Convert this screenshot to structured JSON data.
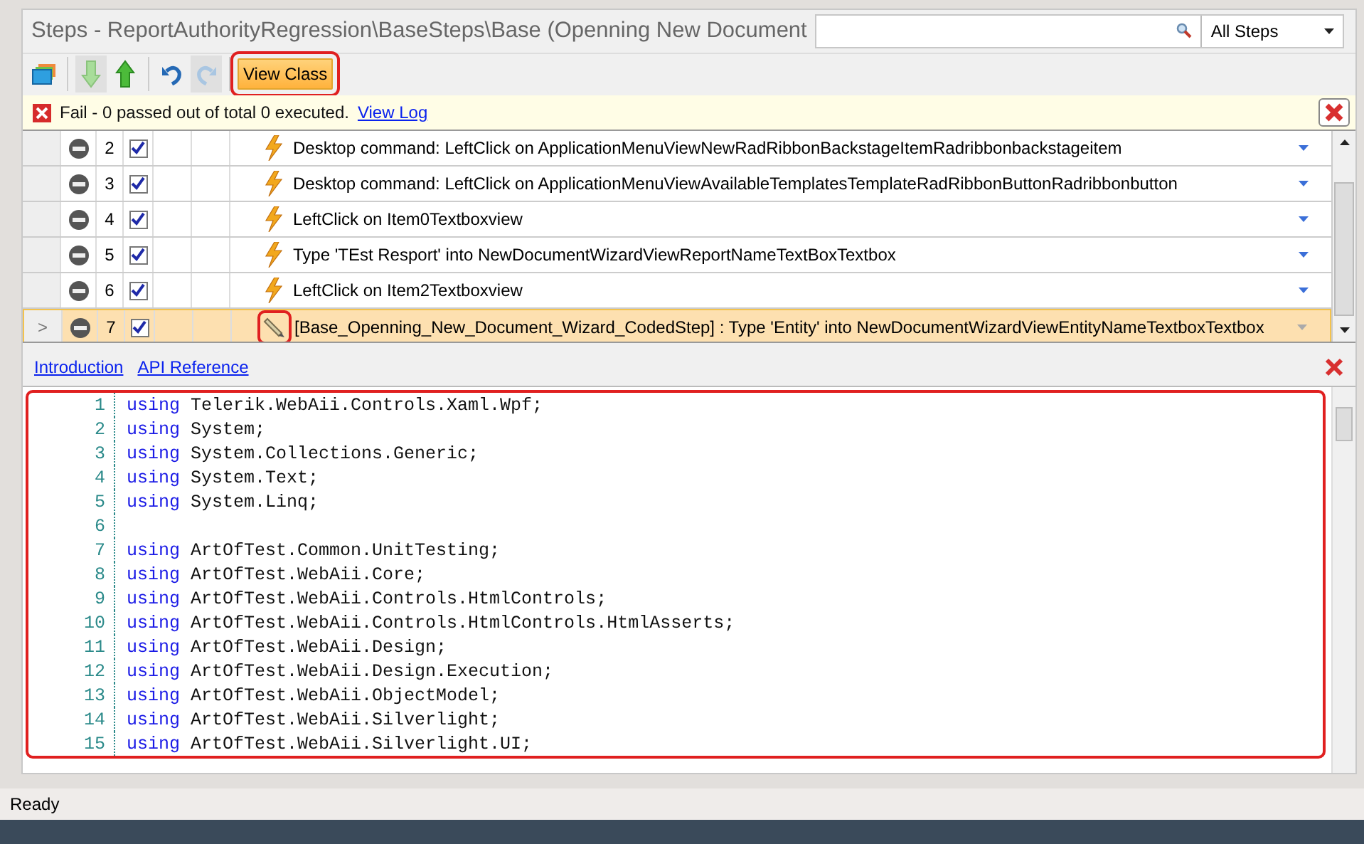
{
  "panel": {
    "title": "Steps - ReportAuthorityRegression\\BaseSteps\\Base (Openning New Document"
  },
  "filter": {
    "scope": "All Steps"
  },
  "toolbar": [
    {
      "kind": "windows",
      "disabled": false
    },
    {
      "kind": "down",
      "disabled": true
    },
    {
      "kind": "up",
      "disabled": false
    },
    {
      "kind": "undo",
      "disabled": false
    },
    {
      "kind": "redo",
      "disabled": true
    },
    {
      "kind": "text",
      "label": "View Class",
      "highlighted": true
    }
  ],
  "result_bar": {
    "message": "Fail - 0 passed out of total 0 executed.",
    "link": "View Log"
  },
  "steps": [
    {
      "number": "2",
      "checked": true,
      "kind": "desktop",
      "description": "Desktop command: LeftClick on ApplicationMenuViewNewRadRibbonBackstageItemRadribbonbackstageitem",
      "selected": false,
      "highlighted": false
    },
    {
      "number": "3",
      "checked": true,
      "kind": "desktop",
      "description": "Desktop command: LeftClick on ApplicationMenuViewAvailableTemplatesTemplateRadRibbonButtonRadribbonbutton",
      "selected": false,
      "highlighted": false
    },
    {
      "number": "4",
      "checked": true,
      "kind": "desktop",
      "description": "LeftClick on Item0Textboxview",
      "selected": false,
      "highlighted": false
    },
    {
      "number": "5",
      "checked": true,
      "kind": "desktop",
      "description": "Type 'TEst Resport' into NewDocumentWizardViewReportNameTextBoxTextbox",
      "selected": false,
      "highlighted": false
    },
    {
      "number": "6",
      "checked": true,
      "kind": "desktop",
      "description": "LeftClick on Item2Textboxview",
      "selected": false,
      "highlighted": false
    },
    {
      "number": "7",
      "checked": true,
      "kind": "coded",
      "description": "[Base_Openning_New_Document_Wizard_CodedStep] : Type 'Entity' into NewDocumentWizardViewEntityNameTextboxTextbox",
      "selected": true,
      "highlighted": true
    }
  ],
  "row_marker": ">",
  "help_links": [
    "Introduction",
    "API Reference"
  ],
  "editor": {
    "highlighted": true,
    "lines": [
      {
        "number": "1",
        "keyword": "using",
        "text": "Telerik.WebAii.Controls.Xaml.Wpf;"
      },
      {
        "number": "2",
        "keyword": "using",
        "text": "System;"
      },
      {
        "number": "3",
        "keyword": "using",
        "text": "System.Collections.Generic;"
      },
      {
        "number": "4",
        "keyword": "using",
        "text": "System.Text;"
      },
      {
        "number": "5",
        "keyword": "using",
        "text": "System.Linq;"
      },
      {
        "number": "6"
      },
      {
        "number": "7",
        "keyword": "using",
        "text": "ArtOfTest.Common.UnitTesting;"
      },
      {
        "number": "8",
        "keyword": "using",
        "text": "ArtOfTest.WebAii.Core;"
      },
      {
        "number": "9",
        "keyword": "using",
        "text": "ArtOfTest.WebAii.Controls.HtmlControls;"
      },
      {
        "number": "10",
        "keyword": "using",
        "text": "ArtOfTest.WebAii.Controls.HtmlControls.HtmlAsserts;"
      },
      {
        "number": "11",
        "keyword": "using",
        "text": "ArtOfTest.WebAii.Design;"
      },
      {
        "number": "12",
        "keyword": "using",
        "text": "ArtOfTest.WebAii.Design.Execution;"
      },
      {
        "number": "13",
        "keyword": "using",
        "text": "ArtOfTest.WebAii.ObjectModel;"
      },
      {
        "number": "14",
        "keyword": "using",
        "text": "ArtOfTest.WebAii.Silverlight;"
      },
      {
        "number": "15",
        "keyword": "using",
        "text": "ArtOfTest.WebAii.Silverlight.UI;"
      }
    ]
  },
  "status_bar": "Ready"
}
